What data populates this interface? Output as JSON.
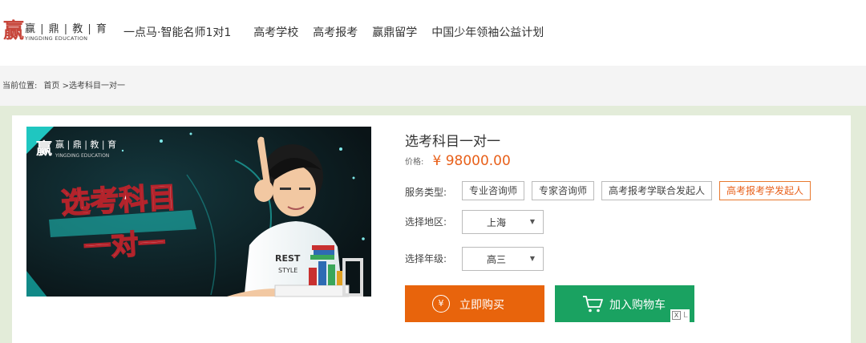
{
  "header": {
    "logo": {
      "mark": "赢",
      "name": "赢 | 鼎 | 教 | 育",
      "english": "YINGDING EDUCATION"
    },
    "nav": [
      "一点马·智能名师1对1",
      "高考学校",
      "高考报考",
      "赢鼎留学",
      "中国少年领袖公益计划"
    ]
  },
  "breadcrumb": {
    "prefix": "当前位置:",
    "home": "首页",
    "current": ">选考科目一对一"
  },
  "banner": {
    "logo_mark": "赢",
    "logo_name": "赢 | 鼎 | 教 | 育",
    "logo_english": "YINGDING EDUCATION",
    "headline_1": "选考科目",
    "headline_2": "一对一"
  },
  "product": {
    "title": "选考科目一对一",
    "price_label": "价格:",
    "price": "¥ 98000.00",
    "service_label": "服务类型:",
    "services": [
      "专业咨询师",
      "专家咨询师",
      "高考报考学联合发起人",
      "高考报考学发起人"
    ],
    "region_label": "选择地区:",
    "region_value": "上海",
    "grade_label": "选择年级:",
    "grade_value": "高三",
    "buy_label": "立即购买",
    "buy_icon_text": "¥",
    "cart_label": "加入购物车"
  },
  "corner": {
    "box": "X",
    "char": "L"
  },
  "colors": {
    "price": "#e8601a",
    "buy": "#e8640c",
    "cart": "#1aa261",
    "accent_border": "#e8792f",
    "panel_bg": "#e3ecd9"
  }
}
